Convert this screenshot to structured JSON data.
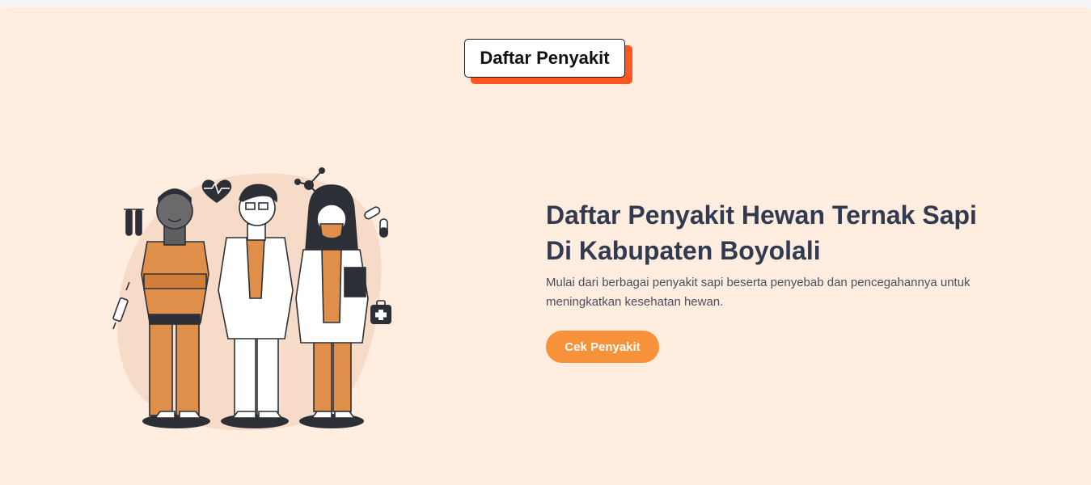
{
  "header": {
    "badge_label": "Daftar Penyakit"
  },
  "hero": {
    "title_line1": "Daftar Penyakit Hewan Ternak Sapi",
    "title_line2": "Di Kabupaten Boyolali",
    "description": "Mulai dari berbagai penyakit sapi beserta penyebab dan pencegahannya untuk meningkatkan kesehatan hewan.",
    "cta_label": "Cek Penyakit"
  },
  "colors": {
    "page_bg": "#ffede0",
    "accent_shadow": "#ff5722",
    "cta_bg": "#f7913a",
    "title": "#323a4f",
    "scrub_orange": "#e08f4a"
  },
  "icons": [
    "heart-pulse-icon",
    "molecule-icon",
    "test-tubes-icon",
    "pill-capsule-icon",
    "syringe-icon",
    "first-aid-kit-icon"
  ]
}
